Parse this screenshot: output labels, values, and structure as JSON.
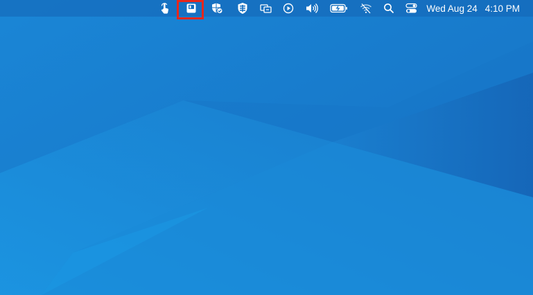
{
  "menubar": {
    "status_icons": [
      {
        "name": "touch-gesture-icon"
      },
      {
        "name": "save-disk-icon",
        "highlighted": true
      },
      {
        "name": "shield-check-icon"
      },
      {
        "name": "vpn-shield-icon"
      },
      {
        "name": "window-switch-icon"
      },
      {
        "name": "play-circle-icon"
      },
      {
        "name": "volume-icon"
      },
      {
        "name": "battery-charging-icon"
      },
      {
        "name": "wifi-off-icon"
      },
      {
        "name": "search-icon"
      },
      {
        "name": "control-center-icon"
      }
    ],
    "date": "Wed Aug 24",
    "time": "4:10 PM"
  },
  "colors": {
    "wallpaper_base": "#1a7fd0",
    "wallpaper_light": "#1e9ae6",
    "wallpaper_dark": "#1466b8",
    "highlight": "#e8271c",
    "menubar_text": "#ffffff"
  }
}
